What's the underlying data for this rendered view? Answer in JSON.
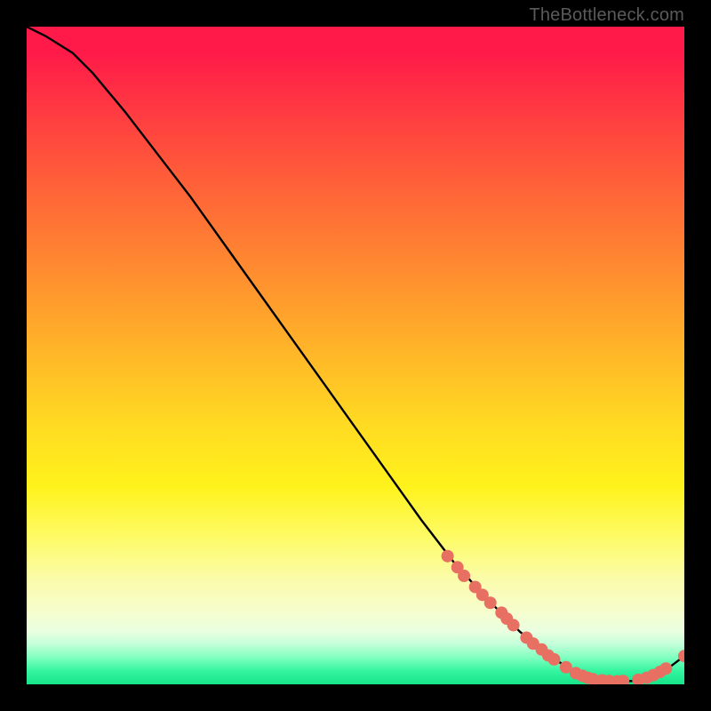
{
  "watermark": "TheBottleneck.com",
  "chart_data": {
    "type": "line",
    "title": "",
    "xlabel": "",
    "ylabel": "",
    "xlim": [
      0,
      100
    ],
    "ylim": [
      0,
      100
    ],
    "curve": [
      {
        "x": 0,
        "y": 100
      },
      {
        "x": 3,
        "y": 98.5
      },
      {
        "x": 7,
        "y": 96
      },
      {
        "x": 10,
        "y": 93
      },
      {
        "x": 15,
        "y": 87
      },
      {
        "x": 20,
        "y": 80.5
      },
      {
        "x": 25,
        "y": 74
      },
      {
        "x": 30,
        "y": 67
      },
      {
        "x": 35,
        "y": 60
      },
      {
        "x": 40,
        "y": 53
      },
      {
        "x": 45,
        "y": 46
      },
      {
        "x": 50,
        "y": 39
      },
      {
        "x": 55,
        "y": 32
      },
      {
        "x": 60,
        "y": 25
      },
      {
        "x": 65,
        "y": 18.5
      },
      {
        "x": 70,
        "y": 13
      },
      {
        "x": 75,
        "y": 8
      },
      {
        "x": 80,
        "y": 4
      },
      {
        "x": 84,
        "y": 1.5
      },
      {
        "x": 88,
        "y": 0.5
      },
      {
        "x": 92,
        "y": 0.5
      },
      {
        "x": 95,
        "y": 1.3
      },
      {
        "x": 98,
        "y": 2.8
      },
      {
        "x": 100,
        "y": 4.3
      }
    ],
    "points": [
      {
        "x": 64,
        "y": 19.5
      },
      {
        "x": 65.5,
        "y": 17.8
      },
      {
        "x": 66.5,
        "y": 16.5
      },
      {
        "x": 68.2,
        "y": 14.8
      },
      {
        "x": 69.3,
        "y": 13.6
      },
      {
        "x": 70.5,
        "y": 12.4
      },
      {
        "x": 72.2,
        "y": 10.9
      },
      {
        "x": 73,
        "y": 10
      },
      {
        "x": 74,
        "y": 9
      },
      {
        "x": 76,
        "y": 7.1
      },
      {
        "x": 77,
        "y": 6.2
      },
      {
        "x": 78.3,
        "y": 5.3
      },
      {
        "x": 79.3,
        "y": 4.4
      },
      {
        "x": 80.2,
        "y": 3.8
      },
      {
        "x": 82,
        "y": 2.6
      },
      {
        "x": 83.5,
        "y": 1.7
      },
      {
        "x": 84.5,
        "y": 1.3
      },
      {
        "x": 85.3,
        "y": 1.0
      },
      {
        "x": 86.1,
        "y": 0.8
      },
      {
        "x": 87.5,
        "y": 0.6
      },
      {
        "x": 88.6,
        "y": 0.5
      },
      {
        "x": 89.8,
        "y": 0.45
      },
      {
        "x": 90.7,
        "y": 0.5
      },
      {
        "x": 93,
        "y": 0.7
      },
      {
        "x": 94.3,
        "y": 1.0
      },
      {
        "x": 95.3,
        "y": 1.4
      },
      {
        "x": 96.3,
        "y": 1.9
      },
      {
        "x": 97.2,
        "y": 2.4
      },
      {
        "x": 100,
        "y": 4.3
      }
    ],
    "colors": {
      "curve": "#000000",
      "markers": "#e77062"
    }
  }
}
